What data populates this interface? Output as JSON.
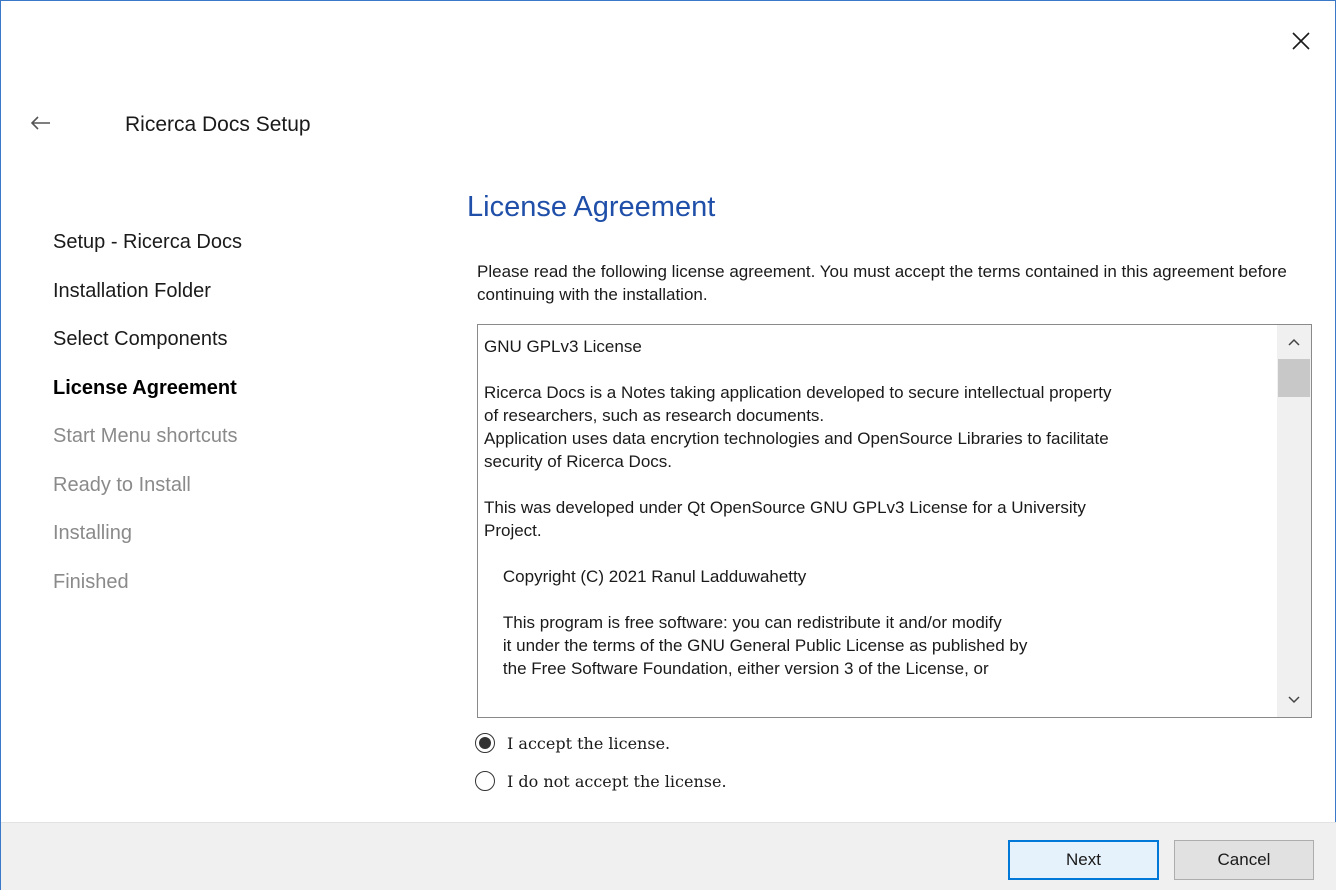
{
  "window": {
    "title": "Ricerca Docs Setup",
    "back_icon": "arrow-left-icon",
    "close_icon": "close-icon"
  },
  "steps": [
    {
      "label": "Setup - Ricerca Docs",
      "state": "done"
    },
    {
      "label": "Installation Folder",
      "state": "done"
    },
    {
      "label": "Select Components",
      "state": "done"
    },
    {
      "label": "License Agreement",
      "state": "active"
    },
    {
      "label": "Start Menu shortcuts",
      "state": "pending"
    },
    {
      "label": "Ready to Install",
      "state": "pending"
    },
    {
      "label": "Installing",
      "state": "pending"
    },
    {
      "label": "Finished",
      "state": "pending"
    }
  ],
  "page": {
    "title": "License Agreement",
    "intro": "Please read the following license agreement. You must accept the terms contained in this agreement before continuing with the installation."
  },
  "license": {
    "text": "GNU GPLv3 License\n\nRicerca Docs is a Notes taking application developed to secure intellectual property\nof researchers, such as research documents.\nApplication uses data encrytion technologies and OpenSource Libraries to facilitate\nsecurity of Ricerca Docs.\n\nThis was developed under Qt OpenSource GNU GPLv3 License for a University\nProject.\n\n    Copyright (C) 2021 Ranul Ladduwahetty\n\n    This program is free software: you can redistribute it and/or modify\n    it under the terms of the GNU General Public License as published by\n    the Free Software Foundation, either version 3 of the License, or"
  },
  "options": {
    "accept": {
      "label": "I accept the license.",
      "selected": true
    },
    "decline": {
      "label": "I do not accept the license.",
      "selected": false
    }
  },
  "buttons": {
    "next": "Next",
    "cancel": "Cancel"
  },
  "colors": {
    "accent": "#1f4fa8",
    "focus_border": "#0078d7",
    "window_border": "#3c78c8",
    "pending_text": "#8a8a8a"
  }
}
